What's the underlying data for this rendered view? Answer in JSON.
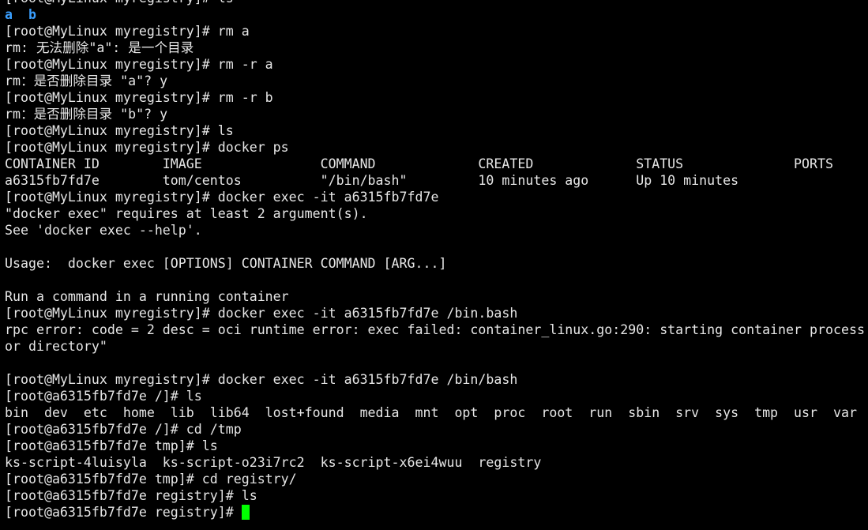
{
  "terminal": {
    "lines": [
      "[root@MyLinux myregistry]# ls",
      "",
      "[root@MyLinux myregistry]# rm a",
      "rm: 无法删除\"a\": 是一个目录",
      "[root@MyLinux myregistry]# rm -r a",
      "rm：是否删除目录 \"a\"? y",
      "[root@MyLinux myregistry]# rm -r b",
      "rm：是否删除目录 \"b\"? y",
      "[root@MyLinux myregistry]# ls",
      "[root@MyLinux myregistry]# docker ps",
      "CONTAINER ID        IMAGE               COMMAND             CREATED             STATUS              PORTS",
      "a6315fb7fd7e        tom/centos          \"/bin/bash\"         10 minutes ago      Up 10 minutes",
      "[root@MyLinux myregistry]# docker exec -it a6315fb7fd7e",
      "\"docker exec\" requires at least 2 argument(s).",
      "See 'docker exec --help'.",
      "",
      "Usage:  docker exec [OPTIONS] CONTAINER COMMAND [ARG...]",
      "",
      "Run a command in a running container",
      "[root@MyLinux myregistry]# docker exec -it a6315fb7fd7e /bin.bash",
      "rpc error: code = 2 desc = oci runtime error: exec failed: container_linux.go:290: starting container process",
      "or directory\"",
      "",
      "[root@MyLinux myregistry]# docker exec -it a6315fb7fd7e /bin/bash",
      "[root@a6315fb7fd7e /]# ls",
      "bin  dev  etc  home  lib  lib64  lost+found  media  mnt  opt  proc  root  run  sbin  srv  sys  tmp  usr  var",
      "[root@a6315fb7fd7e /]# cd /tmp",
      "[root@a6315fb7fd7e tmp]# ls",
      "ks-script-4luisyla  ks-script-o23i7rc2  ks-script-x6ei4wuu  registry",
      "[root@a6315fb7fd7e tmp]# cd registry/",
      "[root@a6315fb7fd7e registry]# ls",
      "[root@a6315fb7fd7e registry]# "
    ],
    "dir_listing": [
      "a",
      "b"
    ],
    "colors": {
      "background": "#000000",
      "text": "#e6e6e6",
      "directory": "#3a9fff",
      "cursor": "#00ff00"
    }
  }
}
